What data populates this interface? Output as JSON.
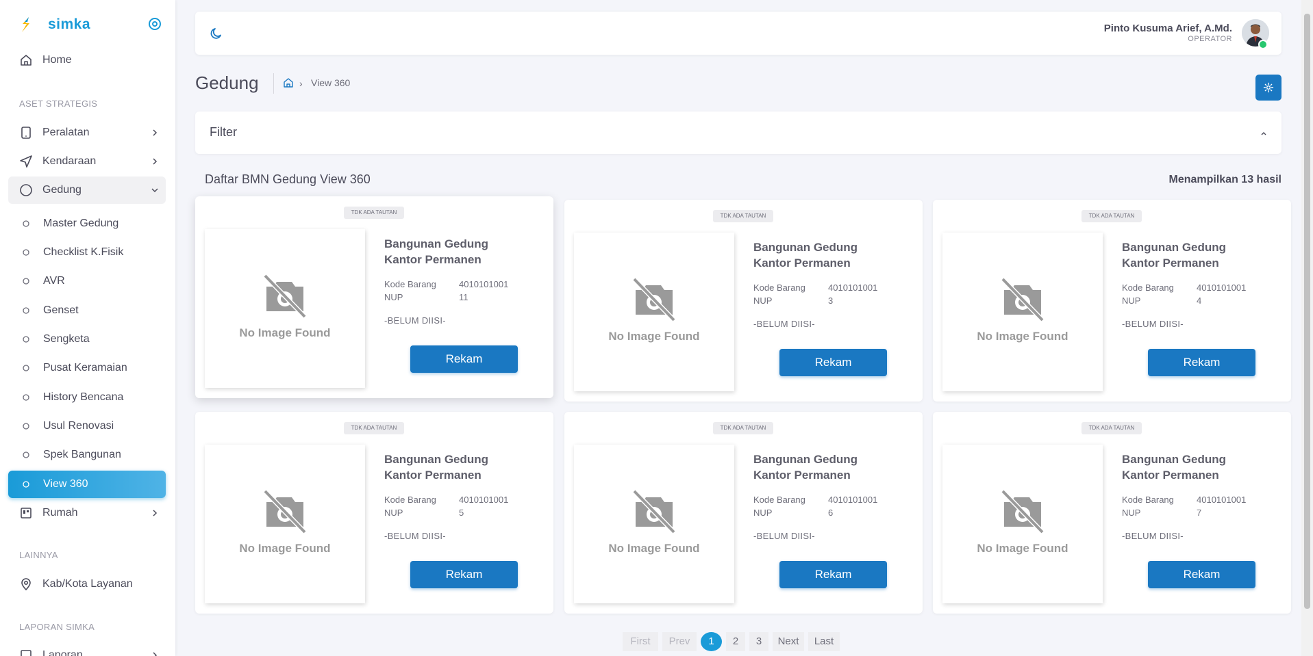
{
  "sidebar": {
    "brand": "simka",
    "home_label": "Home",
    "section_aset": "ASET STRATEGIS",
    "items": [
      {
        "label": "Peralatan"
      },
      {
        "label": "Kendaraan"
      },
      {
        "label": "Gedung"
      }
    ],
    "gedung_sub": [
      {
        "label": "Master Gedung"
      },
      {
        "label": "Checklist K.Fisik"
      },
      {
        "label": "AVR"
      },
      {
        "label": "Genset"
      },
      {
        "label": "Sengketa"
      },
      {
        "label": "Pusat Keramaian"
      },
      {
        "label": "History Bencana"
      },
      {
        "label": "Usul Renovasi"
      },
      {
        "label": "Spek Bangunan"
      },
      {
        "label": "View 360"
      }
    ],
    "rumah_label": "Rumah",
    "section_lainnya": "LAINNYA",
    "kabkota_label": "Kab/Kota Layanan",
    "section_laporan": "LAPORAN SIMKA",
    "laporan_label": "Laporan"
  },
  "topbar": {
    "user_name": "Pinto Kusuma Arief, A.Md.",
    "user_role": "OPERATOR"
  },
  "page": {
    "title": "Gedung",
    "breadcrumb_current": "View 360",
    "breadcrumb_arrow": "›"
  },
  "filter": {
    "title": "Filter"
  },
  "list": {
    "title": "Daftar BMN Gedung View 360",
    "count_text": "Menampilkan 13 hasil"
  },
  "cards": [
    {
      "badge": "TDK ADA TAUTAN",
      "no_image": "No Image Found",
      "title": "Bangunan Gedung Kantor Permanen",
      "kode_label": "Kode Barang",
      "kode": "4010101001",
      "nup_label": "NUP",
      "nup": "11",
      "note": "-BELUM DIISI-",
      "button": "Rekam"
    },
    {
      "badge": "TDK ADA TAUTAN",
      "no_image": "No Image Found",
      "title": "Bangunan Gedung Kantor Permanen",
      "kode_label": "Kode Barang",
      "kode": "4010101001",
      "nup_label": "NUP",
      "nup": "3",
      "note": "-BELUM DIISI-",
      "button": "Rekam"
    },
    {
      "badge": "TDK ADA TAUTAN",
      "no_image": "No Image Found",
      "title": "Bangunan Gedung Kantor Permanen",
      "kode_label": "Kode Barang",
      "kode": "4010101001",
      "nup_label": "NUP",
      "nup": "4",
      "note": "-BELUM DIISI-",
      "button": "Rekam"
    },
    {
      "badge": "TDK ADA TAUTAN",
      "no_image": "No Image Found",
      "title": "Bangunan Gedung Kantor Permanen",
      "kode_label": "Kode Barang",
      "kode": "4010101001",
      "nup_label": "NUP",
      "nup": "5",
      "note": "-BELUM DIISI-",
      "button": "Rekam"
    },
    {
      "badge": "TDK ADA TAUTAN",
      "no_image": "No Image Found",
      "title": "Bangunan Gedung Kantor Permanen",
      "kode_label": "Kode Barang",
      "kode": "4010101001",
      "nup_label": "NUP",
      "nup": "6",
      "note": "-BELUM DIISI-",
      "button": "Rekam"
    },
    {
      "badge": "TDK ADA TAUTAN",
      "no_image": "No Image Found",
      "title": "Bangunan Gedung Kantor Permanen",
      "kode_label": "Kode Barang",
      "kode": "4010101001",
      "nup_label": "NUP",
      "nup": "7",
      "note": "-BELUM DIISI-",
      "button": "Rekam"
    }
  ],
  "pagination": {
    "first": "First",
    "prev": "Prev",
    "pages": [
      "1",
      "2",
      "3"
    ],
    "next": "Next",
    "last": "Last",
    "current": "1"
  },
  "colors": {
    "accent": "#1a9bd8",
    "button": "#1a78c2",
    "online": "#28c76f"
  }
}
